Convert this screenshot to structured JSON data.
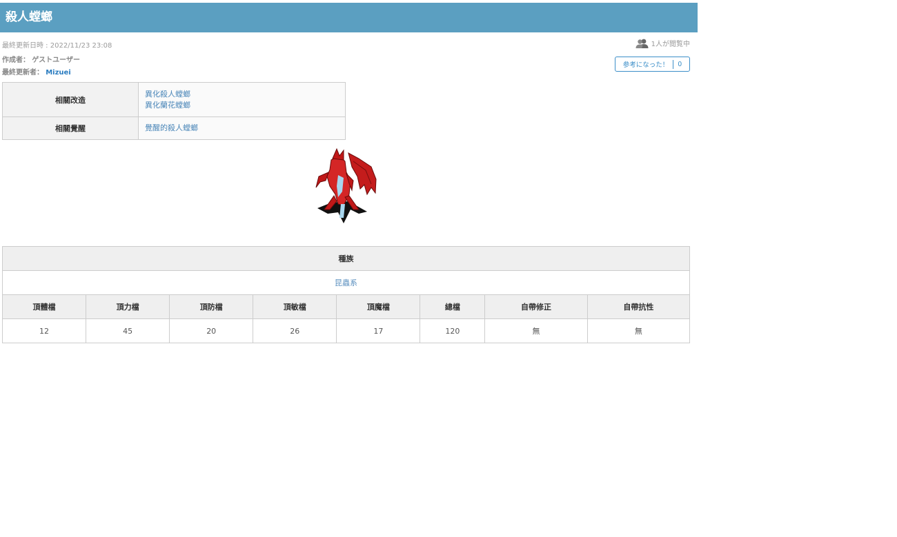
{
  "page": {
    "title": "殺人螳螂"
  },
  "meta": {
    "last_updated": "最終更新日時 : 2022/11/23 23:08",
    "author_label": "作成者：",
    "author": "ゲストユーザー",
    "editor_label": "最終更新者：",
    "editor": "Mizuei"
  },
  "viewers": {
    "icon": "users-icon",
    "text": "1人が閲覧中"
  },
  "helpful": {
    "label": "参考になった！",
    "count": "0"
  },
  "related": {
    "remodel_label": "相關改造",
    "remodel_links": [
      "異化殺人螳螂",
      "異化蘭花螳螂"
    ],
    "awaken_label": "相關覺醒",
    "awaken_link": "覺醒的殺人螳螂"
  },
  "sprite": {
    "icon": "red-mantis-monster-sprite"
  },
  "stats": {
    "race_header": "種族",
    "race_value": "昆蟲系",
    "headers": [
      "頂體檔",
      "頂力檔",
      "頂防檔",
      "頂敏檔",
      "頂魔檔",
      "總檔",
      "自帶修正",
      "自帶抗性"
    ],
    "values": [
      "12",
      "45",
      "20",
      "26",
      "17",
      "120",
      "無",
      "無"
    ]
  }
}
